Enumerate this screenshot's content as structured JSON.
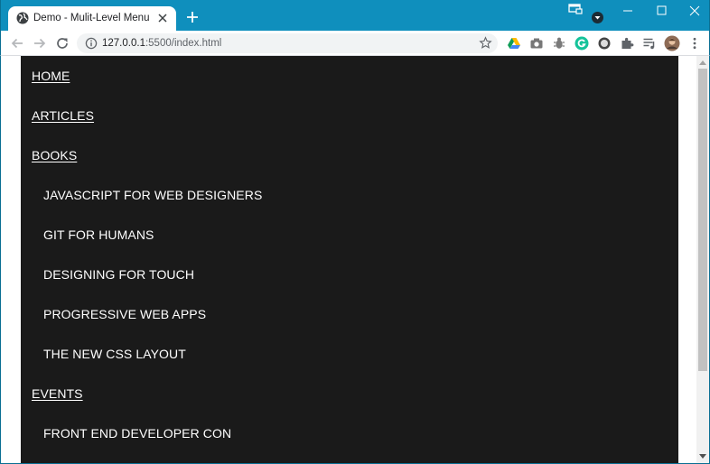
{
  "browser": {
    "tab_title": "Demo - Mulit-Level Menu",
    "url_host": "127.0.0.1",
    "url_path": ":5500/index.html",
    "icons": {
      "favicon": "globe-icon",
      "tab_close": "close-icon",
      "new_tab": "plus-icon",
      "profile_menu": "window-icon",
      "tab_search": "chevron-down-icon",
      "minimize": "minimize-icon",
      "maximize": "maximize-icon",
      "close": "close-icon",
      "back": "arrow-left-icon",
      "forward": "arrow-right-icon",
      "reload": "reload-icon",
      "site_info": "info-icon",
      "bookmark": "star-icon",
      "extensions": [
        "google-drive-icon",
        "camera-icon",
        "bug-icon",
        "grammarly-icon",
        "circle-extension-icon",
        "puzzle-icon",
        "media-queue-icon",
        "avatar",
        "kebab-menu-icon"
      ]
    },
    "colors": {
      "titlebar": "#0f8fbd",
      "page_background": "#1a1a1a",
      "menu_text": "#ffffff"
    }
  },
  "menu": {
    "items": [
      {
        "label": "HOME",
        "level": 1
      },
      {
        "label": "ARTICLES",
        "level": 1
      },
      {
        "label": "BOOKS",
        "level": 1
      },
      {
        "label": "JAVASCRIPT FOR WEB DESIGNERS",
        "level": 2
      },
      {
        "label": "GIT FOR HUMANS",
        "level": 2
      },
      {
        "label": "DESIGNING FOR TOUCH",
        "level": 2
      },
      {
        "label": "PROGRESSIVE WEB APPS",
        "level": 2
      },
      {
        "label": "THE NEW CSS LAYOUT",
        "level": 2
      },
      {
        "label": "EVENTS",
        "level": 1
      },
      {
        "label": "FRONT END DEVELOPER CON",
        "level": 2
      }
    ]
  }
}
